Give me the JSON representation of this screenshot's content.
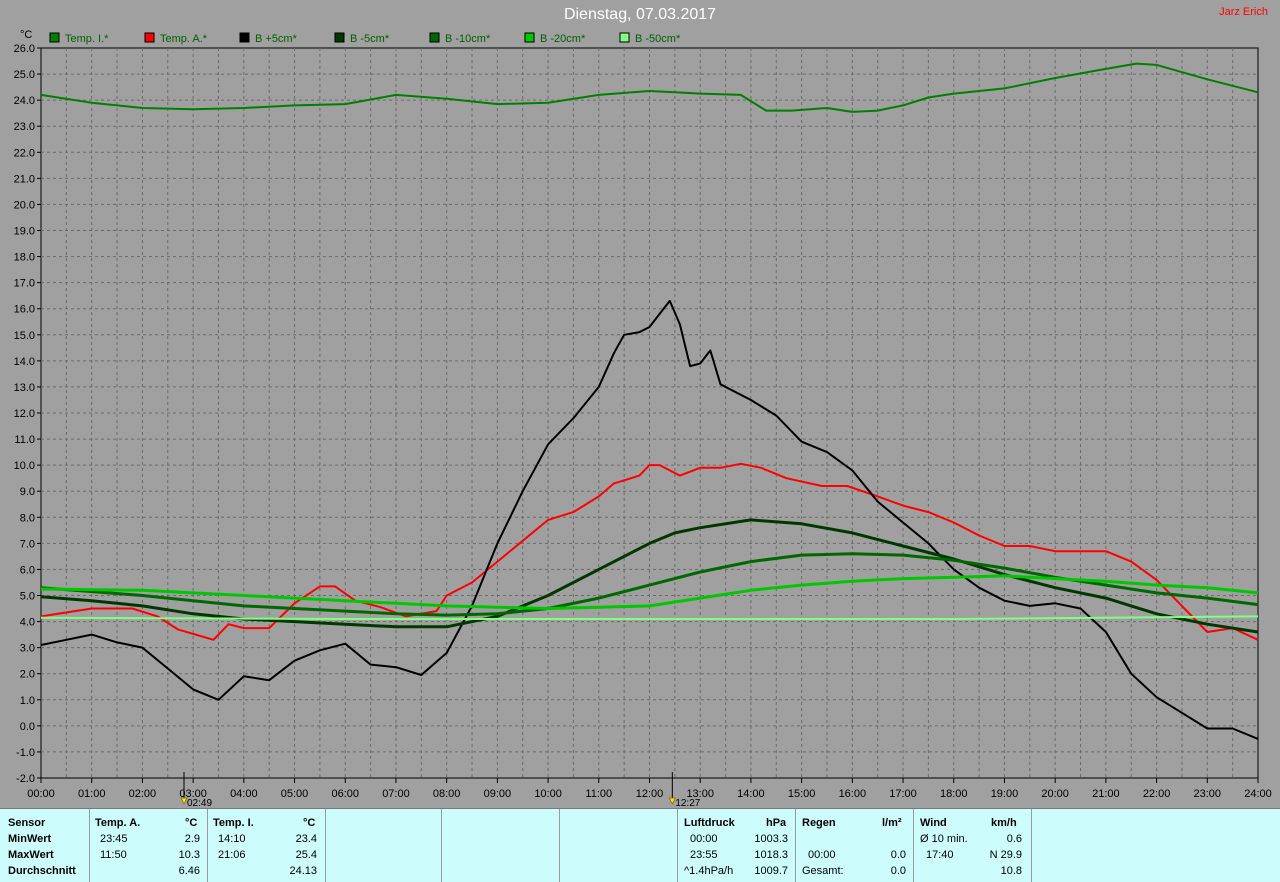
{
  "header": {
    "title": "Dienstag, 07.03.2017",
    "author": "Jarz Erich"
  },
  "chart_data": {
    "type": "line",
    "ylabel": "°C",
    "ylim": [
      -2,
      26
    ],
    "ystep": 1,
    "xlim": [
      0,
      24
    ],
    "grid": true,
    "legend_position": "top",
    "x_tick_labels": [
      "00:00",
      "01:00",
      "02:00",
      "03:00",
      "04:00",
      "05:00",
      "06:00",
      "07:00",
      "08:00",
      "09:00",
      "10:00",
      "11:00",
      "12:00",
      "13:00",
      "14:00",
      "15:00",
      "16:00",
      "17:00",
      "18:00",
      "19:00",
      "20:00",
      "21:00",
      "22:00",
      "23:00",
      "24:00"
    ],
    "markers": [
      {
        "x": 2.82,
        "label": "02:49",
        "icon": "sunrise-icon"
      },
      {
        "x": 12.45,
        "label": "12:27",
        "icon": "sun-icon"
      }
    ],
    "series": [
      {
        "name": "Temp. I.*",
        "color": "#008000",
        "width": 2,
        "points": [
          [
            0,
            24.2
          ],
          [
            1,
            23.9
          ],
          [
            2,
            23.7
          ],
          [
            3,
            23.65
          ],
          [
            4,
            23.7
          ],
          [
            5,
            23.8
          ],
          [
            6,
            23.85
          ],
          [
            7,
            24.2
          ],
          [
            8,
            24.05
          ],
          [
            9,
            23.85
          ],
          [
            10,
            23.9
          ],
          [
            11,
            24.2
          ],
          [
            12,
            24.35
          ],
          [
            12.5,
            24.3
          ],
          [
            13,
            24.25
          ],
          [
            13.8,
            24.2
          ],
          [
            14.3,
            23.6
          ],
          [
            14.8,
            23.6
          ],
          [
            15.5,
            23.7
          ],
          [
            16,
            23.55
          ],
          [
            16.5,
            23.6
          ],
          [
            17,
            23.8
          ],
          [
            17.5,
            24.1
          ],
          [
            18,
            24.25
          ],
          [
            19,
            24.45
          ],
          [
            20,
            24.85
          ],
          [
            21,
            25.2
          ],
          [
            21.6,
            25.4
          ],
          [
            22,
            25.35
          ],
          [
            23,
            24.8
          ],
          [
            24,
            24.3
          ]
        ]
      },
      {
        "name": "Temp. A.*",
        "color": "#ff0000",
        "width": 2,
        "points": [
          [
            0,
            4.2
          ],
          [
            1,
            4.5
          ],
          [
            1.8,
            4.5
          ],
          [
            2.3,
            4.2
          ],
          [
            2.7,
            3.7
          ],
          [
            3.4,
            3.3
          ],
          [
            3.7,
            3.9
          ],
          [
            4,
            3.75
          ],
          [
            4.5,
            3.75
          ],
          [
            5,
            4.7
          ],
          [
            5.5,
            5.35
          ],
          [
            5.8,
            5.35
          ],
          [
            6.2,
            4.8
          ],
          [
            6.7,
            4.55
          ],
          [
            7.2,
            4.2
          ],
          [
            7.8,
            4.4
          ],
          [
            8,
            5.0
          ],
          [
            8.5,
            5.5
          ],
          [
            9,
            6.3
          ],
          [
            9.5,
            7.1
          ],
          [
            10,
            7.9
          ],
          [
            10.5,
            8.2
          ],
          [
            11,
            8.8
          ],
          [
            11.3,
            9.3
          ],
          [
            11.8,
            9.6
          ],
          [
            12,
            10.0
          ],
          [
            12.2,
            10.0
          ],
          [
            12.6,
            9.6
          ],
          [
            13,
            9.9
          ],
          [
            13.4,
            9.9
          ],
          [
            13.8,
            10.05
          ],
          [
            14.2,
            9.9
          ],
          [
            14.7,
            9.5
          ],
          [
            15.4,
            9.2
          ],
          [
            15.9,
            9.2
          ],
          [
            16.5,
            8.8
          ],
          [
            17,
            8.45
          ],
          [
            17.5,
            8.2
          ],
          [
            18,
            7.8
          ],
          [
            18.5,
            7.3
          ],
          [
            19,
            6.9
          ],
          [
            19.5,
            6.9
          ],
          [
            20,
            6.7
          ],
          [
            20.5,
            6.7
          ],
          [
            21,
            6.7
          ],
          [
            21.5,
            6.3
          ],
          [
            22,
            5.6
          ],
          [
            22.5,
            4.6
          ],
          [
            23,
            3.6
          ],
          [
            23.5,
            3.75
          ],
          [
            24,
            3.3
          ]
        ]
      },
      {
        "name": "B +5cm*",
        "color": "#000000",
        "width": 2,
        "points": [
          [
            0,
            3.1
          ],
          [
            0.5,
            3.3
          ],
          [
            1,
            3.5
          ],
          [
            1.5,
            3.2
          ],
          [
            2,
            3.0
          ],
          [
            2.5,
            2.2
          ],
          [
            3,
            1.4
          ],
          [
            3.5,
            1.0
          ],
          [
            4,
            1.9
          ],
          [
            4.5,
            1.75
          ],
          [
            5,
            2.5
          ],
          [
            5.5,
            2.9
          ],
          [
            6,
            3.15
          ],
          [
            6.5,
            2.35
          ],
          [
            7,
            2.25
          ],
          [
            7.5,
            1.95
          ],
          [
            8,
            2.8
          ],
          [
            8.5,
            4.6
          ],
          [
            9,
            7.0
          ],
          [
            9.5,
            9.0
          ],
          [
            10,
            10.8
          ],
          [
            10.5,
            11.8
          ],
          [
            11,
            13.0
          ],
          [
            11.3,
            14.3
          ],
          [
            11.5,
            15.0
          ],
          [
            11.8,
            15.1
          ],
          [
            12,
            15.3
          ],
          [
            12.2,
            15.8
          ],
          [
            12.4,
            16.3
          ],
          [
            12.6,
            15.4
          ],
          [
            12.8,
            13.8
          ],
          [
            13,
            13.9
          ],
          [
            13.2,
            14.4
          ],
          [
            13.4,
            13.1
          ],
          [
            14,
            12.5
          ],
          [
            14.5,
            11.9
          ],
          [
            15,
            10.9
          ],
          [
            15.5,
            10.5
          ],
          [
            16,
            9.8
          ],
          [
            16.5,
            8.6
          ],
          [
            17,
            7.8
          ],
          [
            17.5,
            7.0
          ],
          [
            18,
            6.0
          ],
          [
            18.5,
            5.3
          ],
          [
            19,
            4.8
          ],
          [
            19.5,
            4.6
          ],
          [
            20,
            4.7
          ],
          [
            20.5,
            4.5
          ],
          [
            21,
            3.6
          ],
          [
            21.5,
            2.0
          ],
          [
            22,
            1.1
          ],
          [
            22.5,
            0.5
          ],
          [
            23,
            -0.1
          ],
          [
            23.5,
            -0.1
          ],
          [
            24,
            -0.5
          ]
        ]
      },
      {
        "name": "B -5cm*",
        "color": "#003800",
        "width": 3,
        "points": [
          [
            0,
            4.95
          ],
          [
            1,
            4.8
          ],
          [
            2,
            4.6
          ],
          [
            3,
            4.3
          ],
          [
            4,
            4.1
          ],
          [
            5,
            4.0
          ],
          [
            6,
            3.9
          ],
          [
            7,
            3.8
          ],
          [
            8,
            3.8
          ],
          [
            9,
            4.2
          ],
          [
            10,
            5.0
          ],
          [
            11,
            6.0
          ],
          [
            12,
            7.0
          ],
          [
            12.5,
            7.4
          ],
          [
            13,
            7.6
          ],
          [
            14,
            7.9
          ],
          [
            15,
            7.75
          ],
          [
            16,
            7.4
          ],
          [
            17,
            6.9
          ],
          [
            18,
            6.4
          ],
          [
            19,
            5.8
          ],
          [
            20,
            5.3
          ],
          [
            21,
            4.9
          ],
          [
            22,
            4.3
          ],
          [
            23,
            3.9
          ],
          [
            24,
            3.6
          ]
        ]
      },
      {
        "name": "B -10cm*",
        "color": "#006800",
        "width": 3,
        "points": [
          [
            0,
            5.3
          ],
          [
            2,
            5.0
          ],
          [
            3,
            4.8
          ],
          [
            4,
            4.6
          ],
          [
            5,
            4.5
          ],
          [
            6,
            4.4
          ],
          [
            7,
            4.3
          ],
          [
            8,
            4.25
          ],
          [
            9,
            4.3
          ],
          [
            10,
            4.5
          ],
          [
            11,
            4.9
          ],
          [
            12,
            5.4
          ],
          [
            13,
            5.9
          ],
          [
            14,
            6.3
          ],
          [
            15,
            6.55
          ],
          [
            16,
            6.6
          ],
          [
            17,
            6.55
          ],
          [
            18,
            6.35
          ],
          [
            19,
            6.05
          ],
          [
            20,
            5.7
          ],
          [
            21,
            5.4
          ],
          [
            22,
            5.1
          ],
          [
            23,
            4.9
          ],
          [
            24,
            4.65
          ]
        ]
      },
      {
        "name": "B -20cm*",
        "color": "#00c800",
        "width": 3,
        "points": [
          [
            0,
            5.25
          ],
          [
            2,
            5.2
          ],
          [
            4,
            5.0
          ],
          [
            6,
            4.8
          ],
          [
            8,
            4.6
          ],
          [
            9,
            4.55
          ],
          [
            10,
            4.5
          ],
          [
            11,
            4.55
          ],
          [
            12,
            4.6
          ],
          [
            13,
            4.9
          ],
          [
            14,
            5.2
          ],
          [
            15,
            5.4
          ],
          [
            16,
            5.55
          ],
          [
            17,
            5.65
          ],
          [
            18,
            5.7
          ],
          [
            19,
            5.75
          ],
          [
            20,
            5.65
          ],
          [
            21,
            5.55
          ],
          [
            22,
            5.4
          ],
          [
            23,
            5.3
          ],
          [
            24,
            5.1
          ]
        ]
      },
      {
        "name": "B -50cm*",
        "color": "#80ff80",
        "width": 2,
        "points": [
          [
            0,
            4.15
          ],
          [
            6,
            4.1
          ],
          [
            12,
            4.1
          ],
          [
            18,
            4.1
          ],
          [
            21,
            4.15
          ],
          [
            24,
            4.2
          ]
        ]
      }
    ]
  },
  "stats": {
    "headers": {
      "sensor": "Sensor",
      "temp_a": "Temp. A.",
      "temp_a_unit": "°C",
      "temp_i": "Temp. I.",
      "temp_i_unit": "°C",
      "pressure": "Luftdruck",
      "pressure_unit": "hPa",
      "rain": "Regen",
      "rain_unit": "l/m²",
      "wind": "Wind",
      "wind_unit": "km/h"
    },
    "row_labels": {
      "min": "MinWert",
      "max": "MaxWert",
      "avg": "Durchschnitt"
    },
    "temp_a": {
      "min_time": "23:45",
      "min_val": "2.9",
      "max_time": "11:50",
      "max_val": "10.3",
      "avg": "6.46"
    },
    "temp_i": {
      "min_time": "14:10",
      "min_val": "23.4",
      "max_time": "21:06",
      "max_val": "25.4",
      "avg": "24.13"
    },
    "pressure": {
      "min_time": "00:00",
      "min_val": "1003.3",
      "max_time": "23:55",
      "max_val": "1018.3",
      "trend": "^1.4hPa/h",
      "avg": "1009.7"
    },
    "rain": {
      "time": "00:00",
      "val": "0.0",
      "total_label": "Gesamt:",
      "total": "0.0"
    },
    "wind": {
      "avg_label": "Ø 10 min.",
      "avg_val": "0.6",
      "max_time": "17:40",
      "max_val": "N 29.9",
      "overall": "10.8"
    }
  }
}
